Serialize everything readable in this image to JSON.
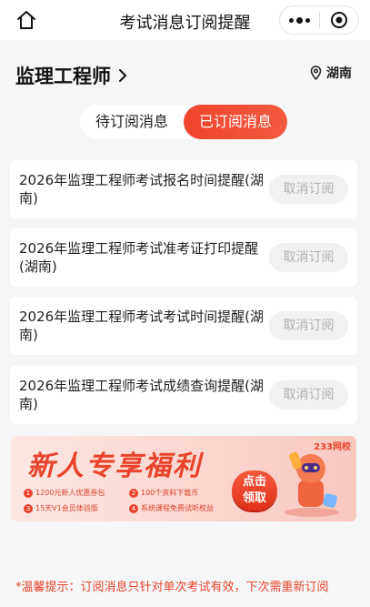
{
  "topbar": {
    "title": "考试消息订阅提醒"
  },
  "header": {
    "exam_name": "监理工程师",
    "location": "湖南"
  },
  "tabs": {
    "pending": "待订阅消息",
    "subscribed": "已订阅消息"
  },
  "subscriptions": [
    {
      "title": "2026年监理工程师考试报名时间提醒(湖南)",
      "action": "取消订阅"
    },
    {
      "title": "2026年监理工程师考试准考证打印提醒(湖南)",
      "action": "取消订阅"
    },
    {
      "title": "2026年监理工程师考试考试时间提醒(湖南)",
      "action": "取消订阅"
    },
    {
      "title": "2026年监理工程师考试成绩查询提醒(湖南)",
      "action": "取消订阅"
    }
  ],
  "banner": {
    "title": "新人专享福利",
    "brand": "233网校",
    "perks": [
      {
        "num": "1",
        "text": "1200元新人优惠券包"
      },
      {
        "num": "2",
        "text": "100个资料下载币"
      },
      {
        "num": "3",
        "text": "15天V1会员体验版"
      },
      {
        "num": "4",
        "text": "系统课程免费试听权益"
      }
    ],
    "claim_line1": "点击",
    "claim_line2": "领取"
  },
  "tip": "*温馨提示：订阅消息只针对单次考试有效，下次需重新订阅",
  "colors": {
    "accent": "#f0452c",
    "background": "#f5f6f8"
  }
}
